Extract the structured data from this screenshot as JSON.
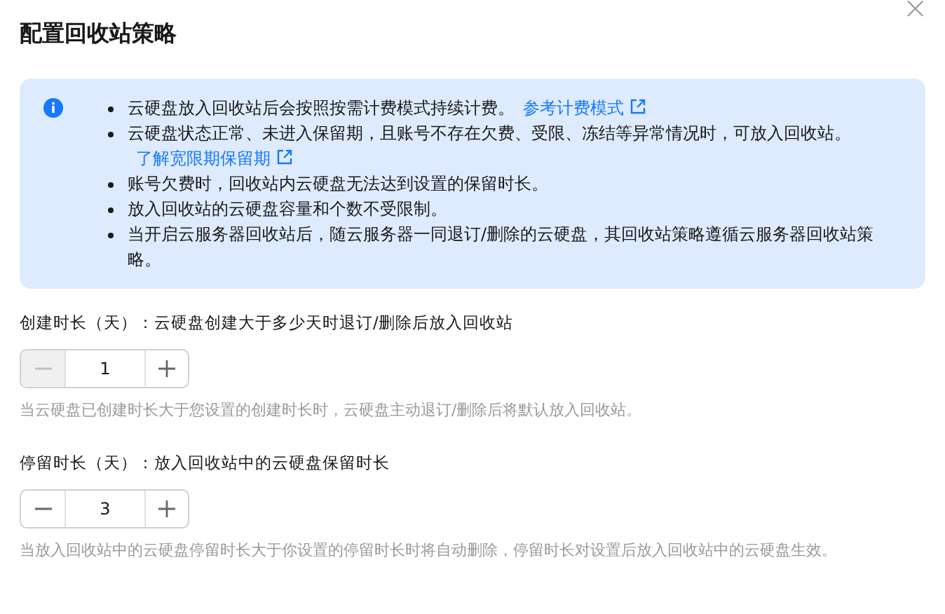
{
  "dialog": {
    "title": "配置回收站策略",
    "close": "×"
  },
  "notes": [
    {
      "text": "云硬盘放入回收站后会按照按需计费模式持续计费。",
      "link": "参考计费模式"
    },
    {
      "text": "云硬盘状态正常、未进入保留期，且账号不存在欠费、受限、冻结等异常情况时，可放入回收站。",
      "link": "了解宽限期保留期"
    },
    {
      "text": "账号欠费时，回收站内云硬盘无法达到设置的保留时长。"
    },
    {
      "text": "放入回收站的云硬盘容量和个数不受限制。"
    },
    {
      "text": "当开启云服务器回收站后，随云服务器一同退订/删除的云硬盘，其回收站策略遵循云服务器回收站策略。"
    }
  ],
  "fields": [
    {
      "label": "创建时长（天）：云硬盘创建大于多少天时退订/删除后放入回收站",
      "value": "1",
      "minus_disabled": true,
      "hint": "当云硬盘已创建时长大于您设置的创建时长时，云硬盘主动退订/删除后将默认放入回收站。"
    },
    {
      "label": "停留时长（天）：放入回收站中的云硬盘保留时长",
      "value": "3",
      "minus_disabled": false,
      "hint": "当放入回收站中的云硬盘停留时长大于你设置的停留时长时将自动删除，停留时长对设置后放入回收站中的云硬盘生效。"
    }
  ]
}
